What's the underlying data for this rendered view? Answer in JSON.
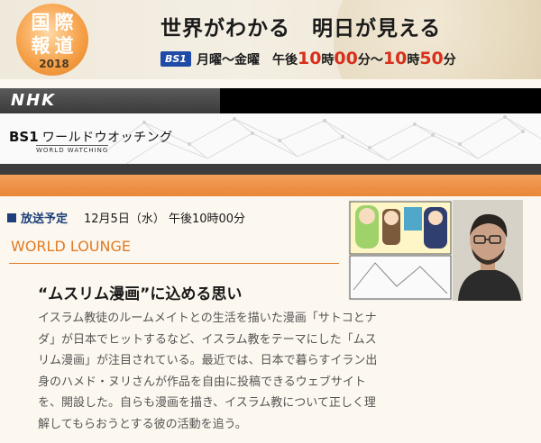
{
  "banner": {
    "logo_kanji": [
      "国",
      "際",
      "報",
      "道"
    ],
    "logo_year": "2018",
    "tagline": "世界がわかる　明日が見える",
    "channel_badge": "BS1",
    "days": "月曜～金曜",
    "time_prefix": "午後",
    "start_hour": "10",
    "start_hour_unit": "時",
    "start_min": "00",
    "start_min_unit": "分～",
    "end_hour": "10",
    "end_hour_unit": "時",
    "end_min": "50",
    "end_min_unit": "分"
  },
  "nhk_bar": {
    "logo": "NHK"
  },
  "program": {
    "channel": "BS1",
    "name": "ワールドウオッチング",
    "subtitle": "WORLD WATCHING"
  },
  "broadcast": {
    "label": "放送予定",
    "datetime": "12月5日（水）  午後10時00分"
  },
  "section_title": "WORLD LOUNGE",
  "article": {
    "headline": "“ムスリム漫画”に込める思い",
    "lines": [
      "イスラム教徒のルームメイトとの生活を描いた漫画「サトコとナ",
      "ダ」が日本でヒットするなど、イスラム教をテーマにした「ムス",
      "リム漫画」が注目されている。最近では、日本で暮らすイラン出",
      "身のハメド・ヌリさんが作品を自由に投稿できるウェブサイト",
      "を、開設した。自らも漫画を描き、イスラム教について正しく理",
      "解してもらおうとする彼の活動を追う。"
    ]
  },
  "colors": {
    "accent_orange": "#e07a23",
    "navy": "#1d3f7a",
    "time_red": "#d8301c",
    "bs1_blue": "#1f4aa7"
  }
}
